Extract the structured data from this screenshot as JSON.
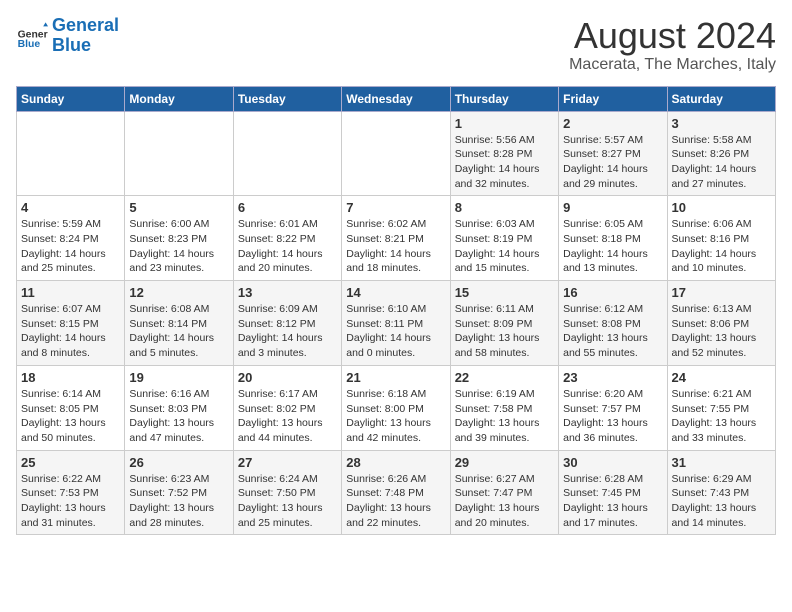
{
  "header": {
    "logo_line1": "General",
    "logo_line2": "Blue",
    "title": "August 2024",
    "subtitle": "Macerata, The Marches, Italy"
  },
  "columns": [
    "Sunday",
    "Monday",
    "Tuesday",
    "Wednesday",
    "Thursday",
    "Friday",
    "Saturday"
  ],
  "weeks": [
    [
      {
        "day": "",
        "info": ""
      },
      {
        "day": "",
        "info": ""
      },
      {
        "day": "",
        "info": ""
      },
      {
        "day": "",
        "info": ""
      },
      {
        "day": "1",
        "info": "Sunrise: 5:56 AM\nSunset: 8:28 PM\nDaylight: 14 hours\nand 32 minutes."
      },
      {
        "day": "2",
        "info": "Sunrise: 5:57 AM\nSunset: 8:27 PM\nDaylight: 14 hours\nand 29 minutes."
      },
      {
        "day": "3",
        "info": "Sunrise: 5:58 AM\nSunset: 8:26 PM\nDaylight: 14 hours\nand 27 minutes."
      }
    ],
    [
      {
        "day": "4",
        "info": "Sunrise: 5:59 AM\nSunset: 8:24 PM\nDaylight: 14 hours\nand 25 minutes."
      },
      {
        "day": "5",
        "info": "Sunrise: 6:00 AM\nSunset: 8:23 PM\nDaylight: 14 hours\nand 23 minutes."
      },
      {
        "day": "6",
        "info": "Sunrise: 6:01 AM\nSunset: 8:22 PM\nDaylight: 14 hours\nand 20 minutes."
      },
      {
        "day": "7",
        "info": "Sunrise: 6:02 AM\nSunset: 8:21 PM\nDaylight: 14 hours\nand 18 minutes."
      },
      {
        "day": "8",
        "info": "Sunrise: 6:03 AM\nSunset: 8:19 PM\nDaylight: 14 hours\nand 15 minutes."
      },
      {
        "day": "9",
        "info": "Sunrise: 6:05 AM\nSunset: 8:18 PM\nDaylight: 14 hours\nand 13 minutes."
      },
      {
        "day": "10",
        "info": "Sunrise: 6:06 AM\nSunset: 8:16 PM\nDaylight: 14 hours\nand 10 minutes."
      }
    ],
    [
      {
        "day": "11",
        "info": "Sunrise: 6:07 AM\nSunset: 8:15 PM\nDaylight: 14 hours\nand 8 minutes."
      },
      {
        "day": "12",
        "info": "Sunrise: 6:08 AM\nSunset: 8:14 PM\nDaylight: 14 hours\nand 5 minutes."
      },
      {
        "day": "13",
        "info": "Sunrise: 6:09 AM\nSunset: 8:12 PM\nDaylight: 14 hours\nand 3 minutes."
      },
      {
        "day": "14",
        "info": "Sunrise: 6:10 AM\nSunset: 8:11 PM\nDaylight: 14 hours\nand 0 minutes."
      },
      {
        "day": "15",
        "info": "Sunrise: 6:11 AM\nSunset: 8:09 PM\nDaylight: 13 hours\nand 58 minutes."
      },
      {
        "day": "16",
        "info": "Sunrise: 6:12 AM\nSunset: 8:08 PM\nDaylight: 13 hours\nand 55 minutes."
      },
      {
        "day": "17",
        "info": "Sunrise: 6:13 AM\nSunset: 8:06 PM\nDaylight: 13 hours\nand 52 minutes."
      }
    ],
    [
      {
        "day": "18",
        "info": "Sunrise: 6:14 AM\nSunset: 8:05 PM\nDaylight: 13 hours\nand 50 minutes."
      },
      {
        "day": "19",
        "info": "Sunrise: 6:16 AM\nSunset: 8:03 PM\nDaylight: 13 hours\nand 47 minutes."
      },
      {
        "day": "20",
        "info": "Sunrise: 6:17 AM\nSunset: 8:02 PM\nDaylight: 13 hours\nand 44 minutes."
      },
      {
        "day": "21",
        "info": "Sunrise: 6:18 AM\nSunset: 8:00 PM\nDaylight: 13 hours\nand 42 minutes."
      },
      {
        "day": "22",
        "info": "Sunrise: 6:19 AM\nSunset: 7:58 PM\nDaylight: 13 hours\nand 39 minutes."
      },
      {
        "day": "23",
        "info": "Sunrise: 6:20 AM\nSunset: 7:57 PM\nDaylight: 13 hours\nand 36 minutes."
      },
      {
        "day": "24",
        "info": "Sunrise: 6:21 AM\nSunset: 7:55 PM\nDaylight: 13 hours\nand 33 minutes."
      }
    ],
    [
      {
        "day": "25",
        "info": "Sunrise: 6:22 AM\nSunset: 7:53 PM\nDaylight: 13 hours\nand 31 minutes."
      },
      {
        "day": "26",
        "info": "Sunrise: 6:23 AM\nSunset: 7:52 PM\nDaylight: 13 hours\nand 28 minutes."
      },
      {
        "day": "27",
        "info": "Sunrise: 6:24 AM\nSunset: 7:50 PM\nDaylight: 13 hours\nand 25 minutes."
      },
      {
        "day": "28",
        "info": "Sunrise: 6:26 AM\nSunset: 7:48 PM\nDaylight: 13 hours\nand 22 minutes."
      },
      {
        "day": "29",
        "info": "Sunrise: 6:27 AM\nSunset: 7:47 PM\nDaylight: 13 hours\nand 20 minutes."
      },
      {
        "day": "30",
        "info": "Sunrise: 6:28 AM\nSunset: 7:45 PM\nDaylight: 13 hours\nand 17 minutes."
      },
      {
        "day": "31",
        "info": "Sunrise: 6:29 AM\nSunset: 7:43 PM\nDaylight: 13 hours\nand 14 minutes."
      }
    ]
  ]
}
